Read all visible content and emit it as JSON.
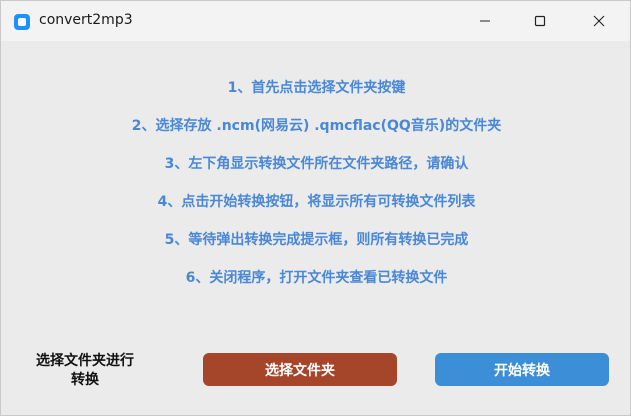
{
  "window": {
    "title": "convert2mp3",
    "app_icon": "app-icon",
    "controls": {
      "minimize": "minimize-icon",
      "maximize": "maximize-icon",
      "close": "close-icon"
    }
  },
  "instructions": [
    "1、首先点击选择文件夹按键",
    "2、选择存放 .ncm(网易云) .qmcflac(QQ音乐)的文件夹",
    "3、左下角显示转换文件所在文件夹路径，请确认",
    "4、点击开始转换按钮，将显示所有可转换文件列表",
    "5、等待弹出转换完成提示框，则所有转换已完成",
    "6、关闭程序，打开文件夹查看已转换文件"
  ],
  "status_label": "选择文件夹进行\n转换",
  "buttons": {
    "select_folder": "选择文件夹",
    "start_convert": "开始转换"
  },
  "colors": {
    "instruction_text": "#4a88d6",
    "select_button": "#a5462a",
    "start_button": "#3c8fd6",
    "background": "#ebebeb"
  }
}
